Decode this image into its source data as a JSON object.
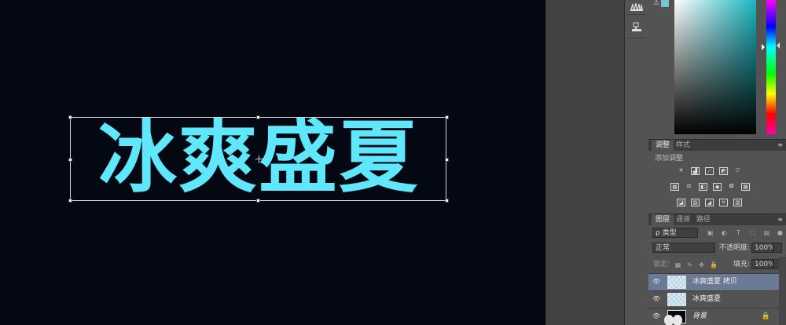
{
  "canvas": {
    "background": "#040812",
    "artwork_text": "冰爽盛夏",
    "artwork_color": "#5fe7fb"
  },
  "toolstrip": {
    "icons": [
      "brushes-icon",
      "clone-source-icon"
    ]
  },
  "color_panel": {
    "current_color": "#5fd4d8",
    "warning_icon": "gamut-warning-icon"
  },
  "adjustments_panel": {
    "tabs": [
      "调整",
      "样式"
    ],
    "title": "添加调整",
    "icon_rows": [
      [
        "brightness-contrast-icon",
        "levels-icon",
        "curves-icon",
        "exposure-icon",
        "vibrance-icon"
      ],
      [
        "hue-saturation-icon",
        "color-balance-icon",
        "black-white-icon",
        "photo-filter-icon",
        "channel-mixer-icon",
        "color-lookup-icon"
      ],
      [
        "invert-icon",
        "posterize-icon",
        "threshold-icon",
        "selective-color-icon",
        "gradient-map-icon"
      ]
    ]
  },
  "layers_panel": {
    "tabs": [
      "图层",
      "通道",
      "路径"
    ],
    "filter_label": "ρ 类型",
    "blend_mode": "正常",
    "opacity_label": "不透明度:",
    "opacity_value": "100%",
    "lock_label": "锁定:",
    "fill_label": "填充:",
    "fill_value": "100%",
    "layers": [
      {
        "name": "冰爽盛夏 拷贝",
        "selected": true,
        "thumb": "transparent"
      },
      {
        "name": "冰爽盛夏",
        "selected": false,
        "thumb": "transparent"
      },
      {
        "name": "背景",
        "selected": false,
        "thumb": "dark",
        "locked": true
      }
    ]
  }
}
